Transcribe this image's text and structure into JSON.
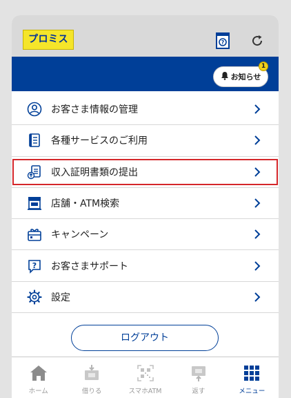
{
  "header": {
    "logo_text": "プロミス",
    "notice_label": "お知らせ",
    "notice_count": "1"
  },
  "menu": {
    "items": [
      {
        "label": "お客さま情報の管理",
        "icon": "user-circle-icon"
      },
      {
        "label": "各種サービスのご利用",
        "icon": "document-list-icon"
      },
      {
        "label": "収入証明書類の提出",
        "icon": "upload-document-icon"
      },
      {
        "label": "店舗・ATM検索",
        "icon": "store-icon"
      },
      {
        "label": "キャンペーン",
        "icon": "gift-icon"
      },
      {
        "label": "お客さまサポート",
        "icon": "help-chat-icon"
      },
      {
        "label": "設定",
        "icon": "gear-icon"
      }
    ],
    "highlighted_index": 2
  },
  "logout_label": "ログアウト",
  "tabbar": {
    "tabs": [
      {
        "label": "ホーム",
        "icon": "home-icon"
      },
      {
        "label": "借りる",
        "icon": "borrow-icon"
      },
      {
        "label": "スマホATM",
        "icon": "qr-code-icon"
      },
      {
        "label": "返す",
        "icon": "repay-icon"
      },
      {
        "label": "メニュー",
        "icon": "grid-menu-icon"
      }
    ],
    "active_index": 4
  },
  "colors": {
    "brand_blue": "#003f98",
    "logo_yellow": "#f5e52a",
    "highlight_red": "#d5262a",
    "inactive_gray": "#9a9a9a"
  }
}
